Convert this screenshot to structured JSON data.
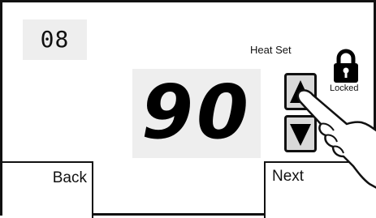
{
  "display": {
    "code": "08",
    "mode_label": "Heat Set",
    "temperature": "90",
    "lock_status": "Locked"
  },
  "buttons": {
    "back_label": "Back",
    "next_label": "Next"
  },
  "icons": {
    "lock": "lock-icon",
    "up": "up-arrow-icon",
    "down": "down-arrow-icon",
    "hand": "pointing-hand-icon"
  }
}
